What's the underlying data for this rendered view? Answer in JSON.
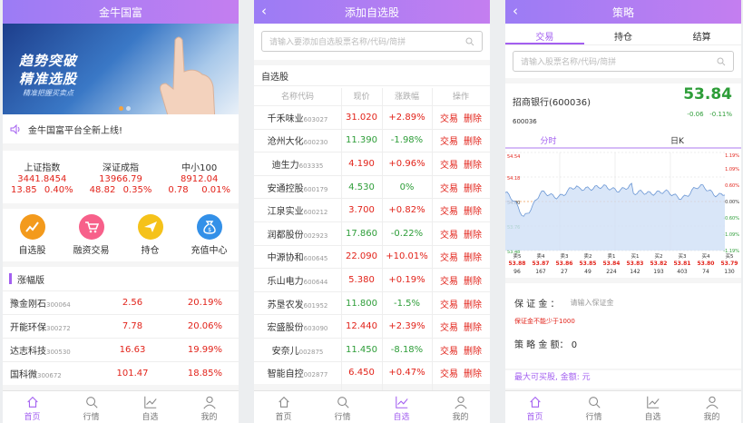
{
  "p1": {
    "title": "金牛国富",
    "banner": {
      "line1": "趋势突破",
      "line2": "精准选股",
      "line3": "精准把握买卖点"
    },
    "notice": "金牛国富平台全新上线!",
    "indices": [
      {
        "name": "上证指数",
        "value": "3441.8454",
        "change": "13.85",
        "pct": "0.40%"
      },
      {
        "name": "深证成指",
        "value": "13966.79",
        "change": "48.82",
        "pct": "0.35%"
      },
      {
        "name": "中小100",
        "value": "8912.04",
        "change": "0.78",
        "pct": "0.01%"
      }
    ],
    "icons": [
      {
        "label": "自选股",
        "color": "#f39a1c",
        "icon": "chart-icon"
      },
      {
        "label": "融资交易",
        "color": "#f7608a",
        "icon": "cart-icon"
      },
      {
        "label": "持仓",
        "color": "#f5c21a",
        "icon": "send-icon"
      },
      {
        "label": "充值中心",
        "color": "#3390e8",
        "icon": "money-bag-icon"
      }
    ],
    "limit_title": "涨幅版",
    "limit_rows": [
      {
        "name": "豫金刚石",
        "code": "300064",
        "price": "2.56",
        "pct": "20.19%"
      },
      {
        "name": "开能环保",
        "code": "300272",
        "price": "7.78",
        "pct": "20.06%"
      },
      {
        "name": "达志科技",
        "code": "300530",
        "price": "16.63",
        "pct": "19.99%"
      },
      {
        "name": "国科微",
        "code": "300672",
        "price": "101.47",
        "pct": "18.85%"
      }
    ]
  },
  "tabbar": [
    "首页",
    "行情",
    "自选",
    "我的"
  ],
  "p2": {
    "title": "添加自选股",
    "search_placeholder": "请输入要添加自选股票名称/代码/简拼",
    "section": "自选股",
    "headers": [
      "名称代码",
      "现价",
      "涨跌幅",
      "操作"
    ],
    "op_trade": "交易",
    "op_delete": "删除",
    "rows": [
      {
        "name": "千禾味业",
        "code": "603027",
        "price": "31.020",
        "pct": "+2.89%",
        "dir": "up"
      },
      {
        "name": "沧州大化",
        "code": "600230",
        "price": "11.390",
        "pct": "-1.98%",
        "dir": "down"
      },
      {
        "name": "迪生力",
        "code": "603335",
        "price": "4.190",
        "pct": "+0.96%",
        "dir": "up"
      },
      {
        "name": "安通控股",
        "code": "600179",
        "price": "4.530",
        "pct": "0%",
        "dir": "down"
      },
      {
        "name": "江泉实业",
        "code": "600212",
        "price": "3.700",
        "pct": "+0.82%",
        "dir": "up"
      },
      {
        "name": "润都股份",
        "code": "002923",
        "price": "17.860",
        "pct": "-0.22%",
        "dir": "down"
      },
      {
        "name": "中源协和",
        "code": "600645",
        "price": "22.090",
        "pct": "+10.01%",
        "dir": "up"
      },
      {
        "name": "乐山电力",
        "code": "600644",
        "price": "5.380",
        "pct": "+0.19%",
        "dir": "up"
      },
      {
        "name": "苏垦农发",
        "code": "601952",
        "price": "11.800",
        "pct": "-1.5%",
        "dir": "down"
      },
      {
        "name": "宏盛股份",
        "code": "603090",
        "price": "12.440",
        "pct": "+2.39%",
        "dir": "up"
      },
      {
        "name": "安奈儿",
        "code": "002875",
        "price": "11.450",
        "pct": "-8.18%",
        "dir": "down"
      },
      {
        "name": "智能自控",
        "code": "002877",
        "price": "6.450",
        "pct": "+0.47%",
        "dir": "up"
      }
    ]
  },
  "p3": {
    "title": "策略",
    "tabs": [
      "交易",
      "持仓",
      "结算"
    ],
    "search_placeholder": "请输入股票名称/代码/简拼",
    "stock_name": "招商银行(600036)",
    "price": "53.84",
    "change": "-0.06",
    "pct": "-0.11%",
    "code": "600036",
    "chart_tabs": [
      "分时",
      "日K"
    ],
    "left_axis": [
      "54.54",
      "54.18",
      "54.00",
      "53.76",
      "53.48"
    ],
    "right_axis": [
      "1.19%",
      "1.09%",
      "0.60%",
      "0.00%",
      "-0.60%",
      "-1.09%",
      "-1.19%"
    ],
    "quotes": [
      {
        "side": "卖5",
        "price": "53.88",
        "vol": "96"
      },
      {
        "side": "卖4",
        "price": "53.87",
        "vol": "167"
      },
      {
        "side": "卖3",
        "price": "53.86",
        "vol": "27"
      },
      {
        "side": "卖2",
        "price": "53.85",
        "vol": "49"
      },
      {
        "side": "卖1",
        "price": "53.84",
        "vol": "224"
      },
      {
        "side": "买1",
        "price": "53.83",
        "vol": "142"
      },
      {
        "side": "买2",
        "price": "53.82",
        "vol": "193"
      },
      {
        "side": "买3",
        "price": "53.81",
        "vol": "403"
      },
      {
        "side": "买4",
        "price": "53.80",
        "vol": "74"
      },
      {
        "side": "买5",
        "price": "53.79",
        "vol": "130"
      }
    ],
    "margin_label": "保 证 金 ：",
    "margin_placeholder": "请输入保证金",
    "margin_warning": "保证金不能少于1000",
    "strategy_label": "策 略 金 额：",
    "strategy_value": "0",
    "max_buy": "最大可买股, 金额: 元"
  },
  "tabbar_active": {
    "p1": 0,
    "p2": 2,
    "p3": 0
  },
  "colors": {
    "accent": "#a35ff0",
    "up": "#e2231a",
    "down": "#2d9d38"
  }
}
